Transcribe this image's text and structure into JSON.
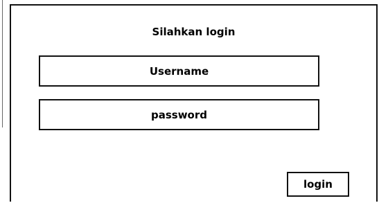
{
  "login_form": {
    "title": "Silahkan login",
    "username_placeholder": "Username",
    "password_placeholder": "password",
    "login_label": "login"
  }
}
